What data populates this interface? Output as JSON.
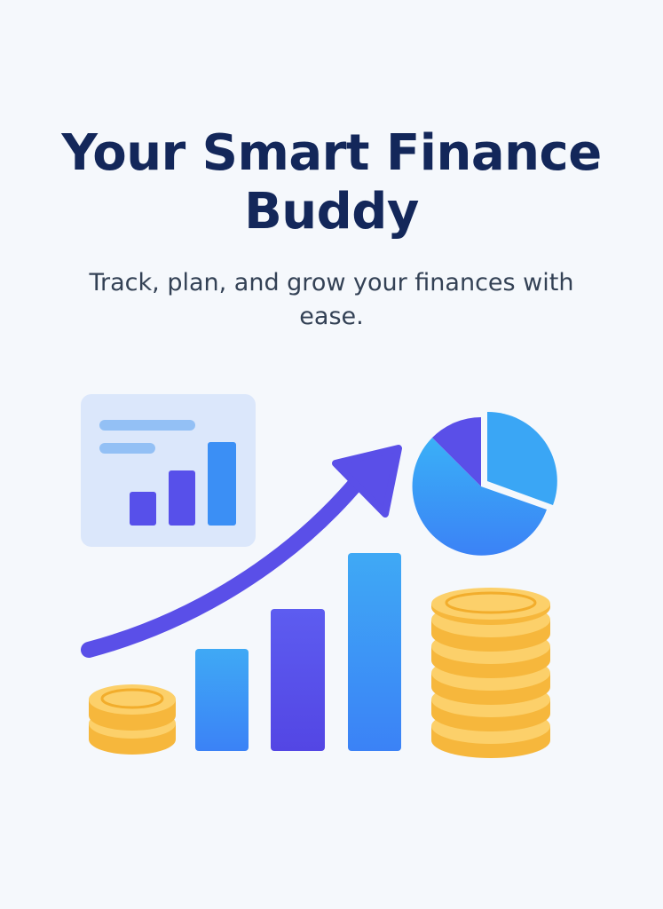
{
  "onboarding": {
    "title": "Your Smart Finance Buddy",
    "subtitle": "Track, plan, and grow your finances with ease."
  },
  "illustration": {
    "icons": [
      "dashboard-card-icon",
      "growth-arrow-icon",
      "pie-chart-icon",
      "bar-chart-icon",
      "coin-stack-icon"
    ],
    "colors": {
      "primary_blue": "#3b82f6",
      "indigo": "#5b4be8",
      "gold": "#fbbf24",
      "card_bg": "#dbe7fb",
      "title": "#13275a",
      "subtitle": "#334155"
    }
  }
}
